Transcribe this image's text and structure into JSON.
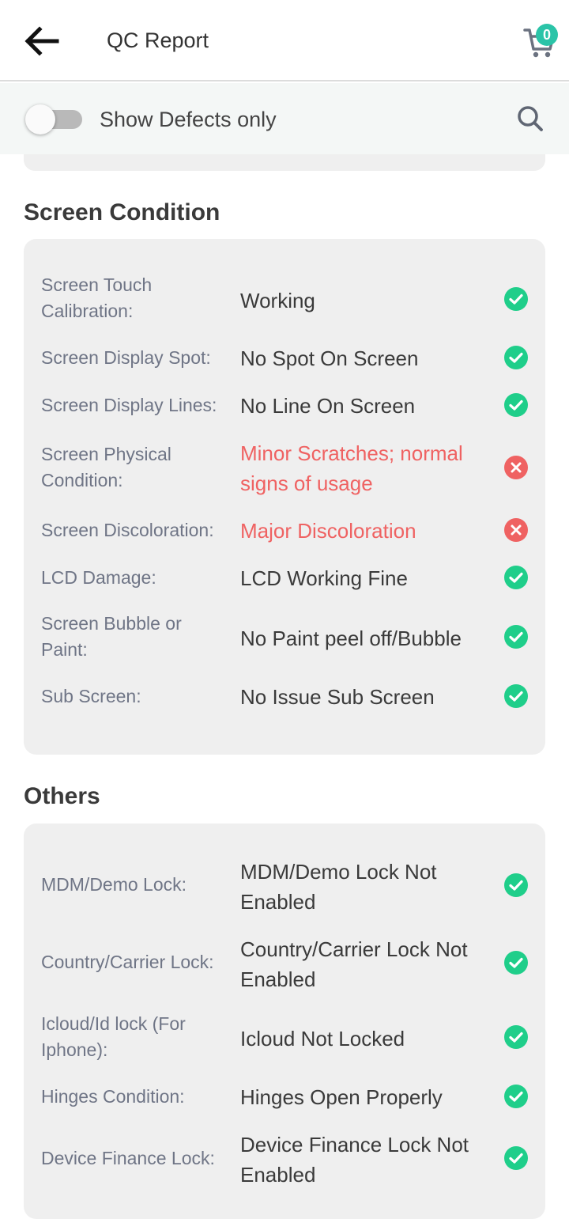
{
  "header": {
    "title": "QC Report",
    "cart_count": "0"
  },
  "filter": {
    "label": "Show Defects only",
    "toggle_on": false
  },
  "colors": {
    "ok": "#1fce8a",
    "defect": "#ef6262",
    "badge": "#2bc4a8"
  },
  "sections": [
    {
      "title": "Screen Condition",
      "rows": [
        {
          "label": "Screen Touch Calibration:",
          "value": "Working",
          "status": "ok"
        },
        {
          "label": "Screen Display Spot:",
          "value": "No Spot On Screen",
          "status": "ok"
        },
        {
          "label": "Screen Display Lines:",
          "value": "No Line On Screen",
          "status": "ok"
        },
        {
          "label": "Screen Physical Condition:",
          "value": "Minor Scratches; normal signs of usage",
          "status": "defect"
        },
        {
          "label": "Screen Discoloration:",
          "value": "Major Discoloration",
          "status": "defect"
        },
        {
          "label": "LCD Damage:",
          "value": "LCD Working Fine",
          "status": "ok"
        },
        {
          "label": "Screen Bubble or Paint:",
          "value": "No Paint peel off/Bubble",
          "status": "ok"
        },
        {
          "label": "Sub Screen:",
          "value": "No Issue Sub Screen",
          "status": "ok"
        }
      ]
    },
    {
      "title": "Others",
      "rows": [
        {
          "label": "MDM/Demo Lock:",
          "value": "MDM/Demo Lock Not Enabled",
          "status": "ok"
        },
        {
          "label": "Country/Carrier Lock:",
          "value": "Country/Carrier Lock Not Enabled",
          "status": "ok"
        },
        {
          "label": "Icloud/Id lock (For Iphone):",
          "value": "Icloud Not Locked",
          "status": "ok"
        },
        {
          "label": "Hinges Condition:",
          "value": "Hinges Open Properly",
          "status": "ok"
        },
        {
          "label": "Device Finance Lock:",
          "value": "Device Finance Lock Not Enabled",
          "status": "ok"
        }
      ]
    }
  ]
}
